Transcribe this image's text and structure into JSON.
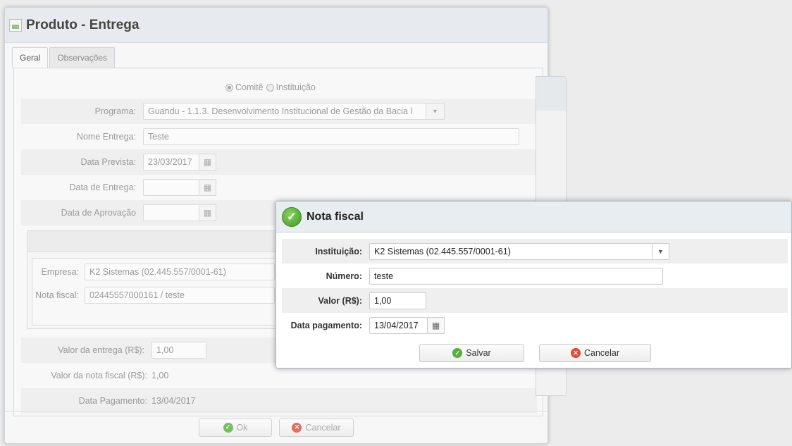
{
  "background_window": {
    "title": "Produto - Entrega",
    "tabs": [
      "Geral",
      "Observações"
    ],
    "radio_options": [
      "Comitê",
      "Instituição"
    ],
    "fields": {
      "programa_label": "Programa:",
      "programa_value": "Guandu - 1.1.3. Desenvolvimento Institucional de Gestão da Bacia l",
      "nome_label": "Nome Entrega:",
      "nome_value": "Teste",
      "data_prevista_label": "Data Prevista:",
      "data_prevista_value": "23/03/2017",
      "data_entrega_label": "Data de Entrega:",
      "data_entrega_value": "",
      "data_aprovacao_label": "Data de Aprovação",
      "data_aprovacao_value": "",
      "empresa_label": "Empresa:",
      "empresa_value": "K2 Sistemas (02.445.557/0001-61)",
      "nota_label": "Nota fiscal:",
      "nota_value": "02445557000161 / teste",
      "valor_entrega_label": "Valor da entrega (R$):",
      "valor_entrega_value": "1,00",
      "valor_nota_label": "Valor da nota fiscal (R$):",
      "valor_nota_value": "1,00",
      "data_pagamento_label": "Data Pagamento:",
      "data_pagamento_value": "13/04/2017"
    },
    "buttons": {
      "ok": "Ok",
      "cancel": "Cancelar"
    }
  },
  "modal": {
    "title": "Nota fiscal",
    "instituicao_label": "Instituição:",
    "instituicao_value": "K2 Sistemas (02.445.557/0001-61)",
    "numero_label": "Número:",
    "numero_value": "teste",
    "valor_label": "Valor (R$):",
    "valor_value": "1,00",
    "data_label": "Data pagamento:",
    "data_value": "13/04/2017",
    "save_label": "Salvar",
    "cancel_label": "Cancelar"
  },
  "icons": {
    "calendar": "calendar-icon",
    "dropdown": "chevron-down-icon",
    "ok": "check-circle-icon",
    "cancel": "x-circle-icon"
  }
}
